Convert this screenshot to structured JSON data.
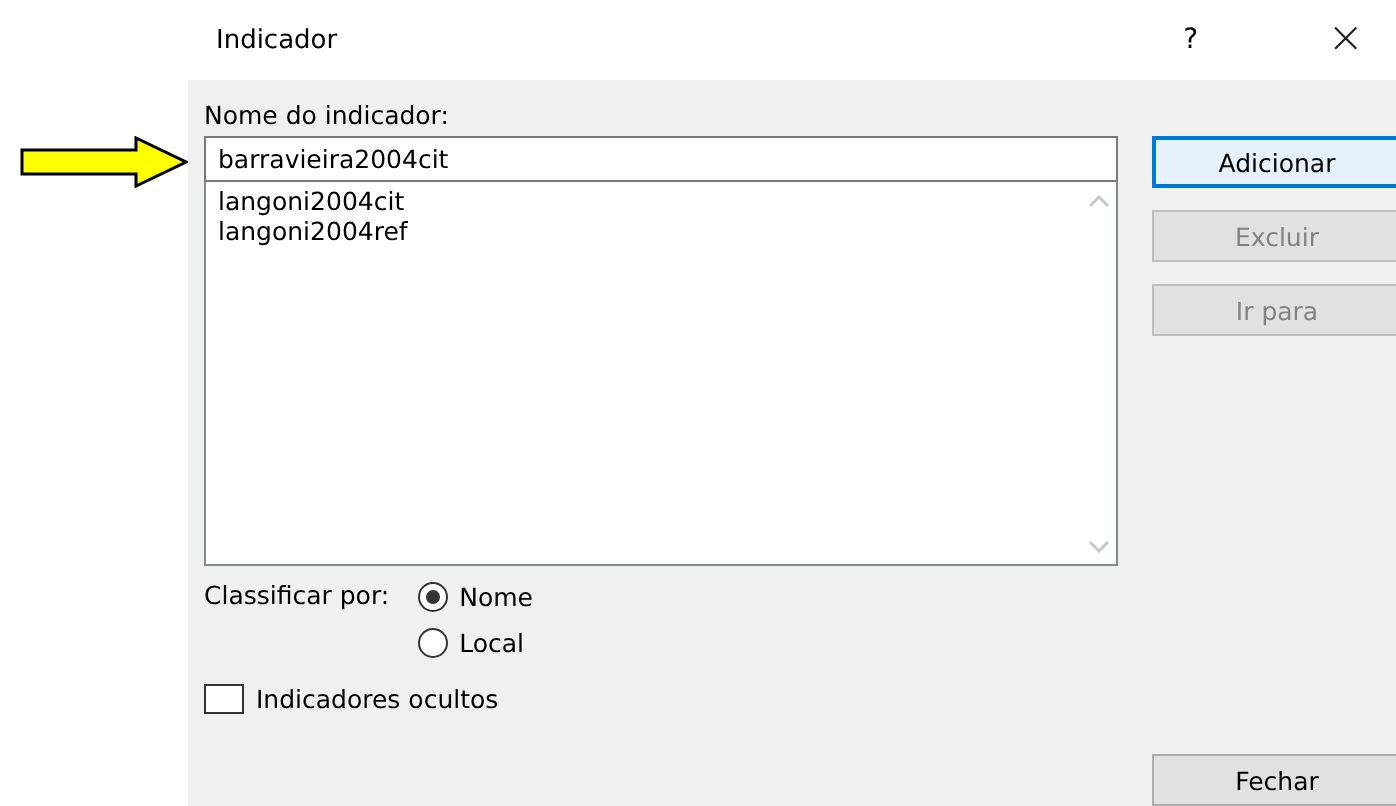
{
  "window": {
    "title": "Indicador",
    "help": "?",
    "close": "×"
  },
  "name_label": "Nome do indicador:",
  "name_field": {
    "value": "barravieira2004cit"
  },
  "list": {
    "items": [
      {
        "label": "langoni2004cit"
      },
      {
        "label": "langoni2004ref"
      }
    ]
  },
  "buttons": [
    {
      "label": "Adicionar",
      "default": true,
      "disabled": false
    },
    {
      "label": "Excluir",
      "default": false,
      "disabled": true
    },
    {
      "label": "Ir para",
      "default": false,
      "disabled": true
    }
  ],
  "sort": {
    "label": "Classificar por:",
    "options": [
      {
        "label": "Nome",
        "selected": true
      },
      {
        "label": "Local",
        "selected": false
      }
    ]
  },
  "hidden_option": {
    "label": "Indicadores ocultos",
    "checked": false
  },
  "close_button": {
    "label": "Fechar",
    "default": false,
    "disabled": false
  }
}
